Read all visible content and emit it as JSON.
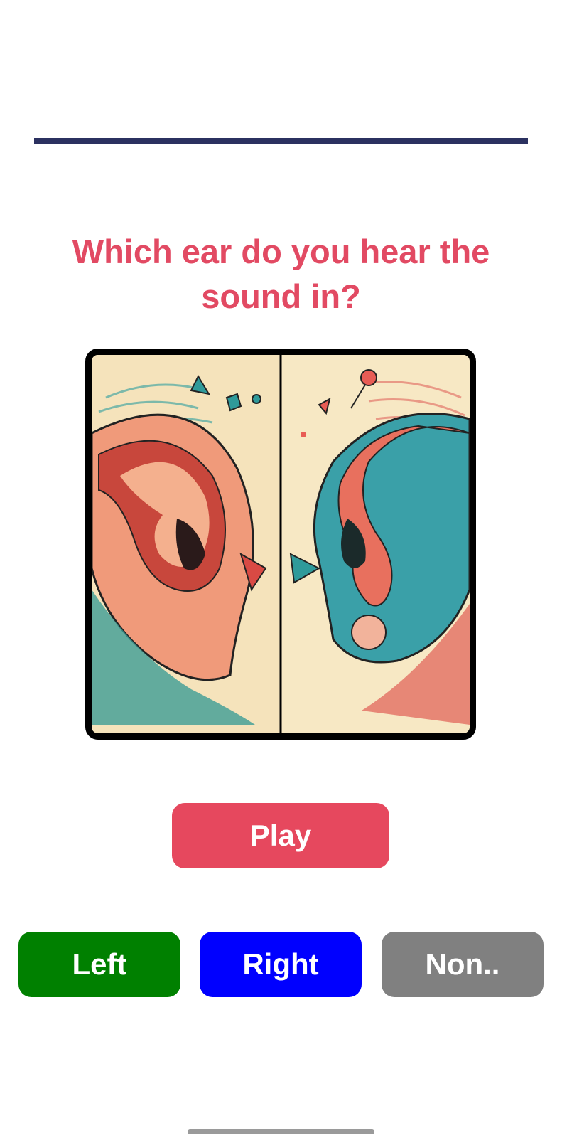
{
  "quiz": {
    "question": "Which ear do you hear the sound in?",
    "progress": 1.0,
    "illustration_icon": "two-ears-illustration"
  },
  "controls": {
    "play_label": "Play",
    "answers": {
      "left_label": "Left",
      "right_label": "Right",
      "none_label": "Non.."
    }
  },
  "colors": {
    "question_text": "#e24a63",
    "progress": "#2b3160",
    "play": "#e6485e",
    "left": "#008000",
    "right": "#0000ff",
    "none": "#808080"
  }
}
